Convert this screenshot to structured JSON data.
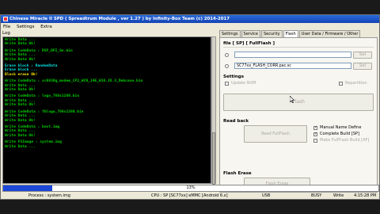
{
  "window": {
    "title": "Chinese Miracle II SPD ( Spreadtrum Module , ver 1.27 ) by Infinity-Box Team (c) 2014-2017"
  },
  "menu": [
    "File",
    "Settings",
    "Extra"
  ],
  "log": {
    "label": "Log",
    "lines": [
      {
        "t": "Write Data ...",
        "c": "g"
      },
      {
        "t": "Write Data Ok!",
        "c": "g"
      },
      {
        "t": "",
        "c": "blank"
      },
      {
        "t": "Write CodeData : DSP_DFI_Gn.bin",
        "c": "g"
      },
      {
        "t": "Write Data ...",
        "c": "g"
      },
      {
        "t": "Write Data Ok!",
        "c": "g"
      },
      {
        "t": "",
        "c": "blank"
      },
      {
        "t": "Erase block : RandomData",
        "c": "c"
      },
      {
        "t": "Erase block ...",
        "c": "c"
      },
      {
        "t": "Block erase Ok!",
        "c": "y"
      },
      {
        "t": "",
        "c": "blank"
      },
      {
        "t": "Write CodeData : sc8830g_modem_CP2_WCN_14E_W16.26.3_Debcase.bin",
        "c": "g"
      },
      {
        "t": "Write Data ...",
        "c": "g"
      },
      {
        "t": "Write Data Ok!",
        "c": "g"
      },
      {
        "t": "",
        "c": "blank"
      },
      {
        "t": "Write CodeData : logo_768x1280.bin",
        "c": "g"
      },
      {
        "t": "Write Data ...",
        "c": "g"
      },
      {
        "t": "Write Data Ok!",
        "c": "g"
      },
      {
        "t": "",
        "c": "blank"
      },
      {
        "t": "Write CodeData : fblogo_768x1280.bin",
        "c": "g"
      },
      {
        "t": "Write Data ...",
        "c": "g"
      },
      {
        "t": "Write Data Ok!",
        "c": "g"
      },
      {
        "t": "",
        "c": "blank"
      },
      {
        "t": "Write CodeData : boot.img",
        "c": "g"
      },
      {
        "t": "Write Data ...",
        "c": "g"
      },
      {
        "t": "Write Data Ok!",
        "c": "g"
      },
      {
        "t": "",
        "c": "blank"
      },
      {
        "t": "Write FSImage : system.img",
        "c": "g"
      },
      {
        "t": "Write Data ...",
        "c": "g"
      }
    ]
  },
  "tabs": [
    "Settings",
    "Service",
    "Security",
    "Flash",
    "User Data / Firmware / Other"
  ],
  "flash": {
    "section_file": "file [ SP] [ FullFlash ]",
    "file1_value": "",
    "file1_btn": "Sel",
    "file2_value": "SC77xx_FLASH_CORR.pac.sc",
    "file2_btn": "Sel",
    "settings_label": "Settings",
    "update_nvm": "Update NVM",
    "repartition": "Repartition",
    "flash_btn": "Flash",
    "readback_label": "Read back",
    "read_fullflash_btn": "Read FullFlash",
    "manual_name": "Manual Name Define",
    "complete_build": "Complete Build [SP]",
    "make_fullflash": "Make FullFlash Build [AF]",
    "flash_erase_label": "Flash Erase",
    "flash_erase_btn": "Flash Erase"
  },
  "progress": {
    "percent": 13,
    "label": "13%"
  },
  "status": {
    "process": "Process : system.img",
    "cpu": "CPU : SP [SC77xx] eMMC [Android 6.x]",
    "usb": "USB",
    "busy": "BUSY",
    "mode": "Write",
    "time": "4:15:28 PM"
  }
}
